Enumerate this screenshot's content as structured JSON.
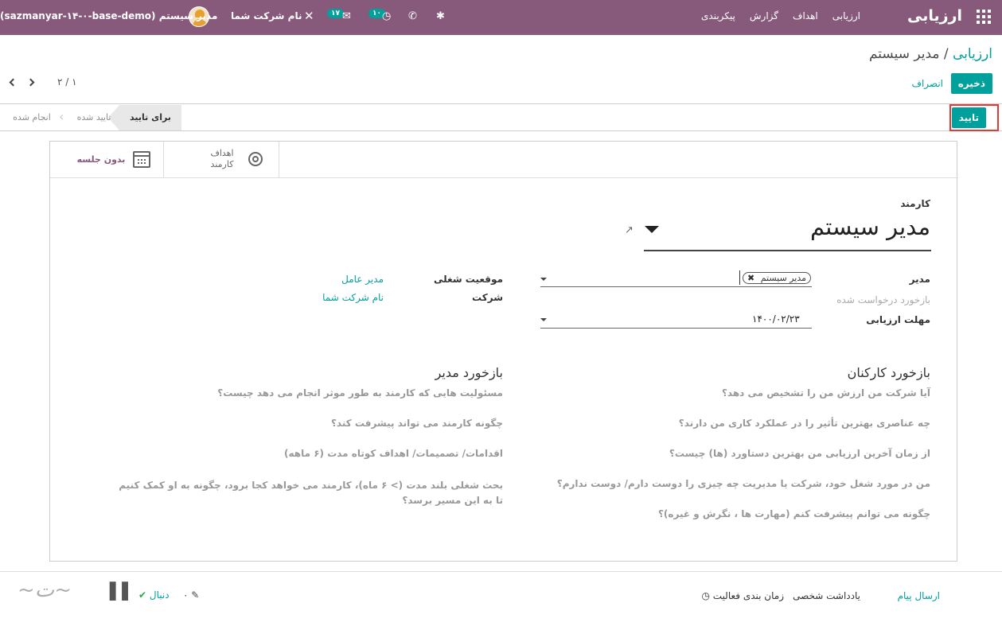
{
  "navbar": {
    "brand": "ارزیابی",
    "menu": [
      "ارزیابی",
      "اهداف",
      "گزارش",
      "پیکربندی"
    ],
    "company": "نام شرکت شما",
    "user": "مدیر سیستم (sazmanyar-۱۴-۰-base-demo)",
    "badges": {
      "messages": "۱۷",
      "activities": "۱۰"
    },
    "icons": [
      "apps-grid-icon",
      "bug-icon",
      "phone-icon",
      "clock-icon",
      "chat-icon",
      "tools-icon"
    ]
  },
  "control_panel": {
    "breadcrumb_root": "ارزیابی",
    "breadcrumb_sep": "/",
    "breadcrumb_current": "مدیر سیستم",
    "save_label": "ذخیره",
    "discard_label": "انصراف",
    "pager": "۲ / ۱"
  },
  "statusbar": {
    "confirm_label": "تایید",
    "stages": [
      {
        "label": "برای تایید",
        "active": true
      },
      {
        "label": "تایید شده",
        "active": false
      },
      {
        "label": "انجام شده",
        "active": false
      }
    ]
  },
  "smart_buttons": {
    "goals_line1": "اهداف",
    "goals_line2": "کارمند",
    "meeting_label": "بدون جلسه"
  },
  "form": {
    "employee_label": "کارمند",
    "employee_name": "مدیر سیستم",
    "manager_label": "مدیر",
    "manager_tag": "مدیر سیستم",
    "feedback_requested_label": "بازخورد درخواست شده",
    "deadline_label": "مهلت ارزیابی",
    "deadline_value": "۱۴۰۰/۰۲/۲۳",
    "job_position_label": "موقعیت شغلی",
    "job_position_value": "مدیر عامل",
    "company_label": "شرکت",
    "company_value": "نام شرکت شما"
  },
  "employee_feedback": {
    "title": "بازخورد کارکنان",
    "questions": [
      "آیا شرکت من ارزش من را تشخیص می دهد؟",
      "چه عناصری بهترین تأثیر را در عملکرد کاری من دارند؟",
      "از زمان آخرین ارزیابی من بهترین دستاورد (ها) چیست؟",
      "من در مورد شغل خود، شرکت یا مدیریت چه چیزی را دوست دارم/ دوست ندارم؟",
      "چگونه می توانم پیشرفت کنم (مهارت ها ، نگرش و غیره)؟"
    ]
  },
  "manager_feedback": {
    "title": "بازخورد مدیر",
    "questions": [
      "مسئولیت هایی که کارمند به طور موثر انجام می دهد چیست؟",
      "چگونه کارمند می تواند پیشرفت کند؟",
      "اقدامات/ تصمیمات/ اهداف کوتاه مدت (۶ ماهه)",
      "بحث شغلی بلند مدت (> ۶ ماه)، کارمند می خواهد کجا برود، چگونه به او کمک کنیم تا به این مسیر برسد؟"
    ]
  },
  "chatter": {
    "send_message": "ارسال پیام",
    "log_note": "یادداشت شخصی",
    "schedule_activity": "زمان بندی فعالیت",
    "attachments": "۰",
    "follow": "دنبال",
    "watermark": "سازمان‌یار"
  },
  "colors": {
    "navbar": "#875a7b",
    "accent": "#00a09d",
    "highlight": "#e53935"
  }
}
